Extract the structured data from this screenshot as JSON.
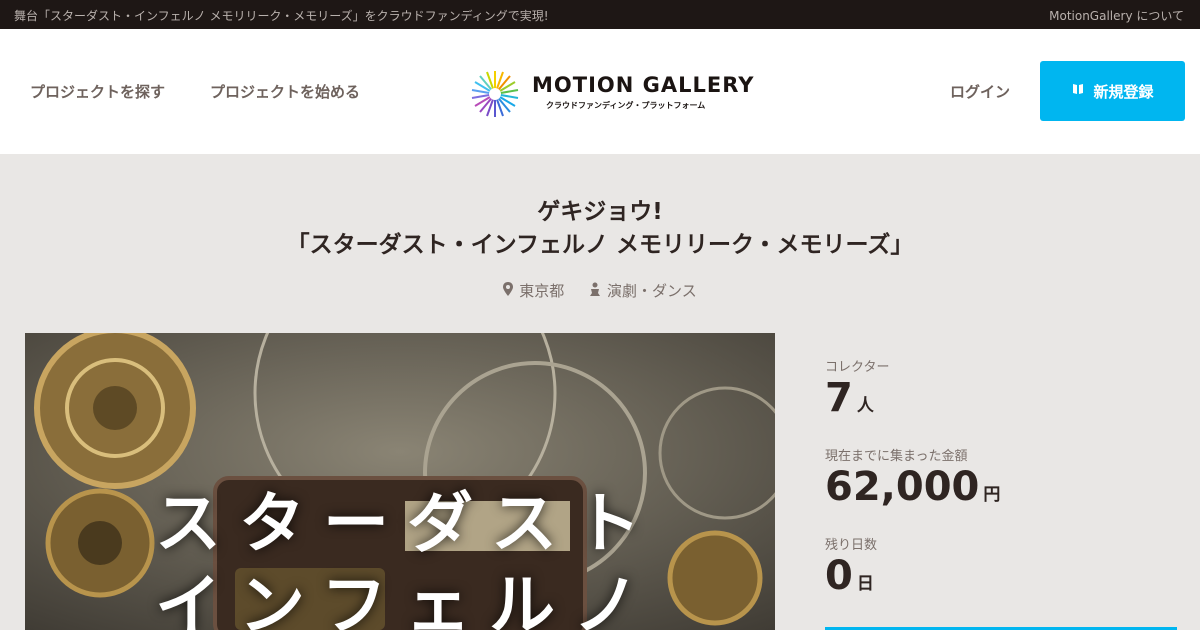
{
  "topbar": {
    "tagline": "舞台「スターダスト・インフェルノ メモリリーク・メモリーズ」をクラウドファンディングで実現!",
    "about_link": "MotionGallery について"
  },
  "header": {
    "find_project": "プロジェクトを探す",
    "start_project": "プロジェクトを始める",
    "logo_wordmark": "MOTION GALLERY",
    "logo_tagline": "クラウドファンディング・プラットフォーム",
    "login": "ログイン",
    "signup": "新規登録",
    "signup_icon": "book-icon"
  },
  "project": {
    "title_line1": "ゲキジョウ!",
    "title_line2": "「スターダスト・インフェルノ メモリリーク・メモリーズ」",
    "location": "東京都",
    "location_icon": "map-pin-icon",
    "category": "演劇・ダンス",
    "category_icon": "person-icon",
    "hero_text_line1": "スターダスト",
    "hero_text_line2": "インフェルノ"
  },
  "stats": {
    "collectors_label": "コレクター",
    "collectors_value": "7",
    "collectors_unit": "人",
    "amount_label": "現在までに集まった金額",
    "amount_value": "62,000",
    "amount_unit": "円",
    "days_label": "残り日数",
    "days_value": "0",
    "days_unit": "日"
  },
  "colors": {
    "accent": "#00b6f0",
    "topbar_bg": "#1e1715",
    "page_bg": "#e9e7e5"
  }
}
